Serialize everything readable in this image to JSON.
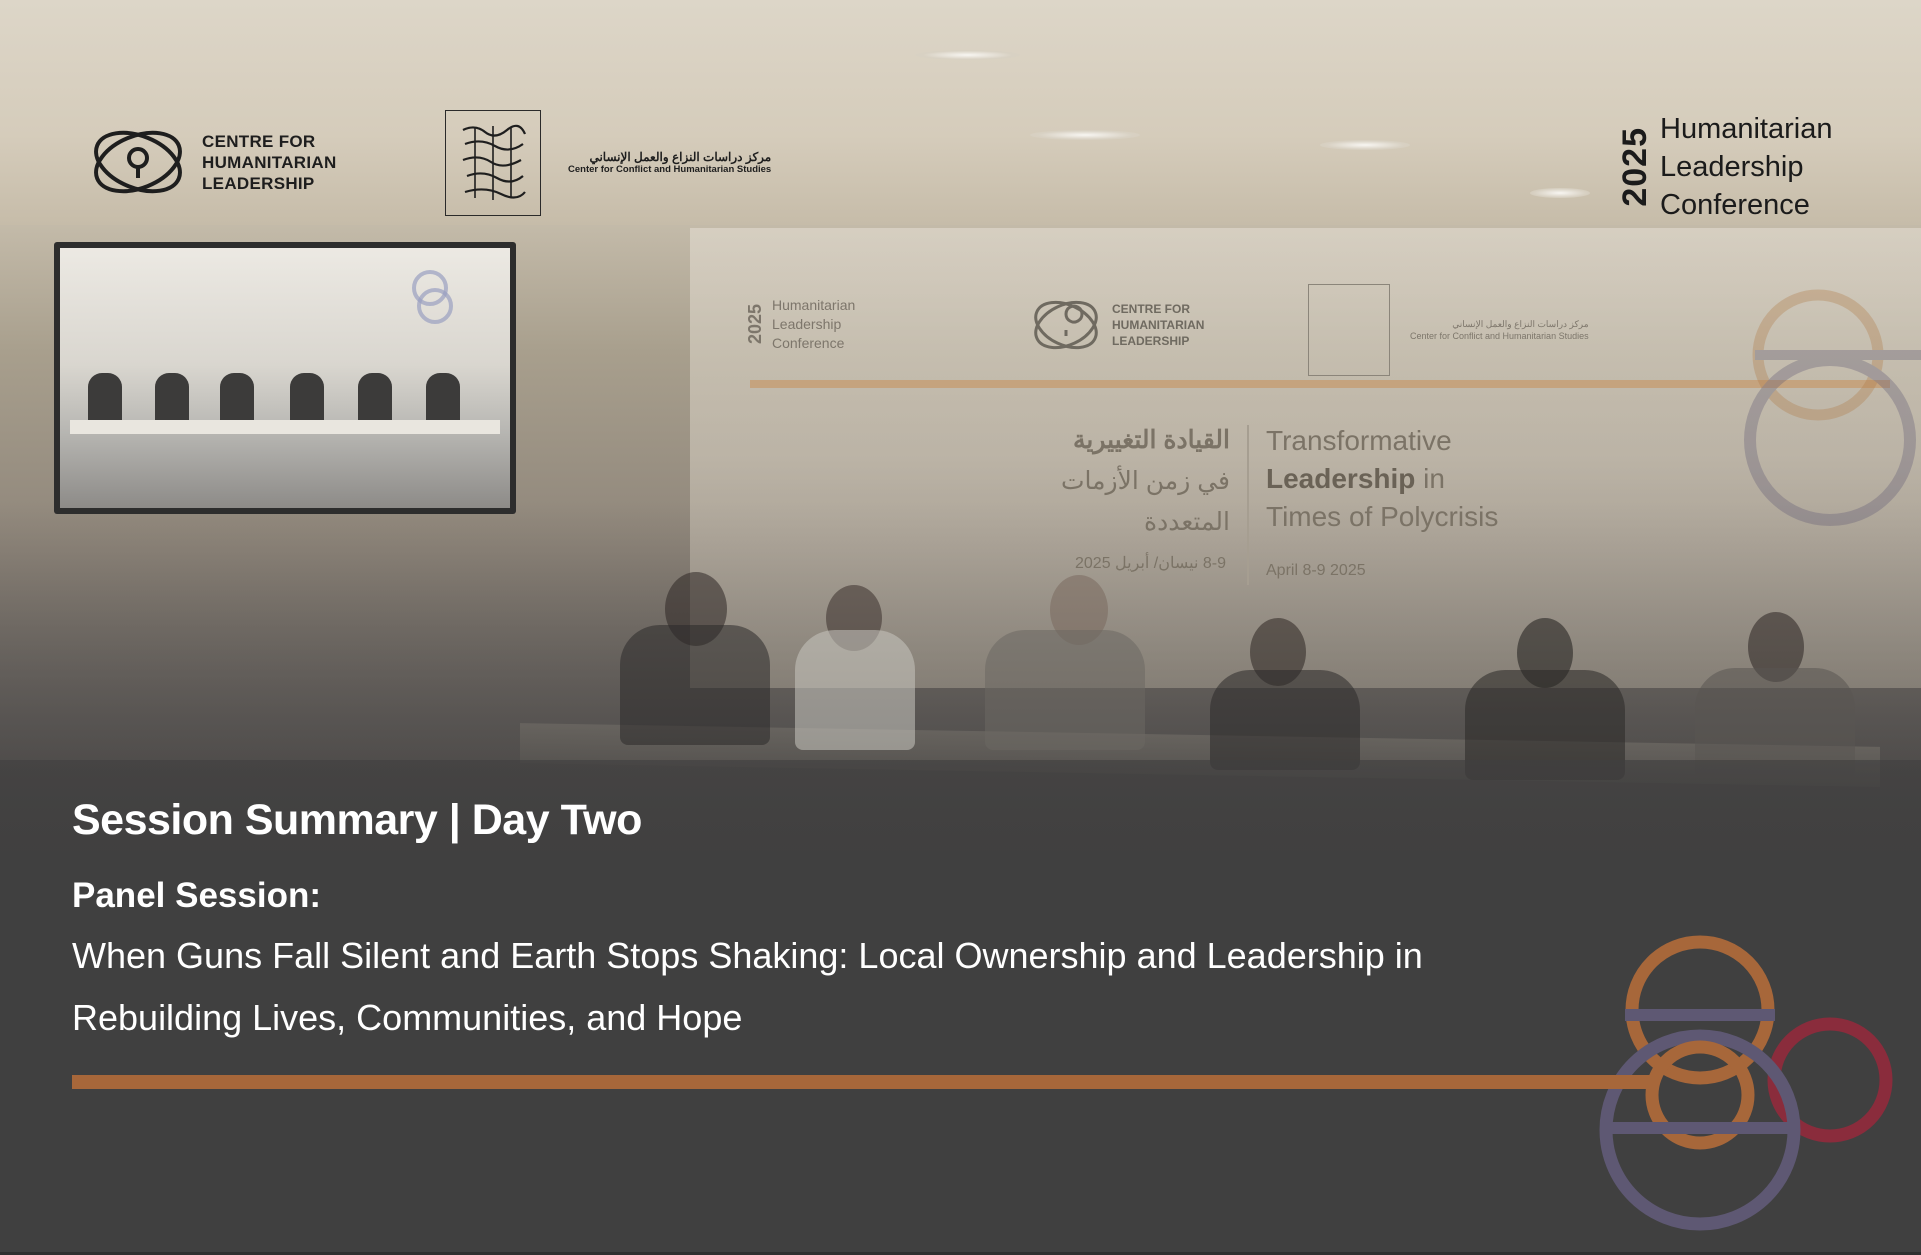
{
  "header": {
    "chl_logo": [
      "CENTRE FOR",
      "HUMANITARIAN",
      "LEADERSHIP"
    ],
    "ccs_logo_ar": "مركز دراسات النزاع والعمل الإنساني",
    "ccs_logo_en": "Center for Conflict and Humanitarian Studies",
    "conference_year": "2025",
    "conference_name": [
      "Humanitarian",
      "Leadership",
      "Conference"
    ]
  },
  "backdrop": {
    "hlc_year": "2025",
    "hlc_lines": [
      "Humanitarian",
      "Leadership",
      "Conference"
    ],
    "chl_lines": [
      "CENTRE FOR",
      "HUMANITARIAN",
      "LEADERSHIP"
    ],
    "ccs_ar": "مركز دراسات النزاع والعمل الإنساني",
    "ccs_en": "Center for Conflict and Humanitarian Studies",
    "title_ar": [
      "القيادة التغييرية",
      "في زمن الأزمات",
      "المتعددة"
    ],
    "title_en_1": "Transformative",
    "title_en_2_bold": "Leadership",
    "title_en_2_rest": " in",
    "title_en_3": "Times of Polycrisis",
    "date_ar": "8-9 نيسان/ أبريل 2025",
    "date_en": "April 8-9 2025"
  },
  "summary": {
    "title": "Session Summary | Day Two",
    "label": "Panel Session:",
    "description": "When Guns Fall Silent and Earth Stops Shaking: Local Ownership and Leadership in Rebuilding Lives, Communities, and Hope"
  },
  "colors": {
    "accent_bar": "#a7673a",
    "ring_orange": "#a7673a",
    "ring_purple": "#5e5873",
    "ring_red": "#8a2c3c",
    "text": "#ffffff"
  }
}
